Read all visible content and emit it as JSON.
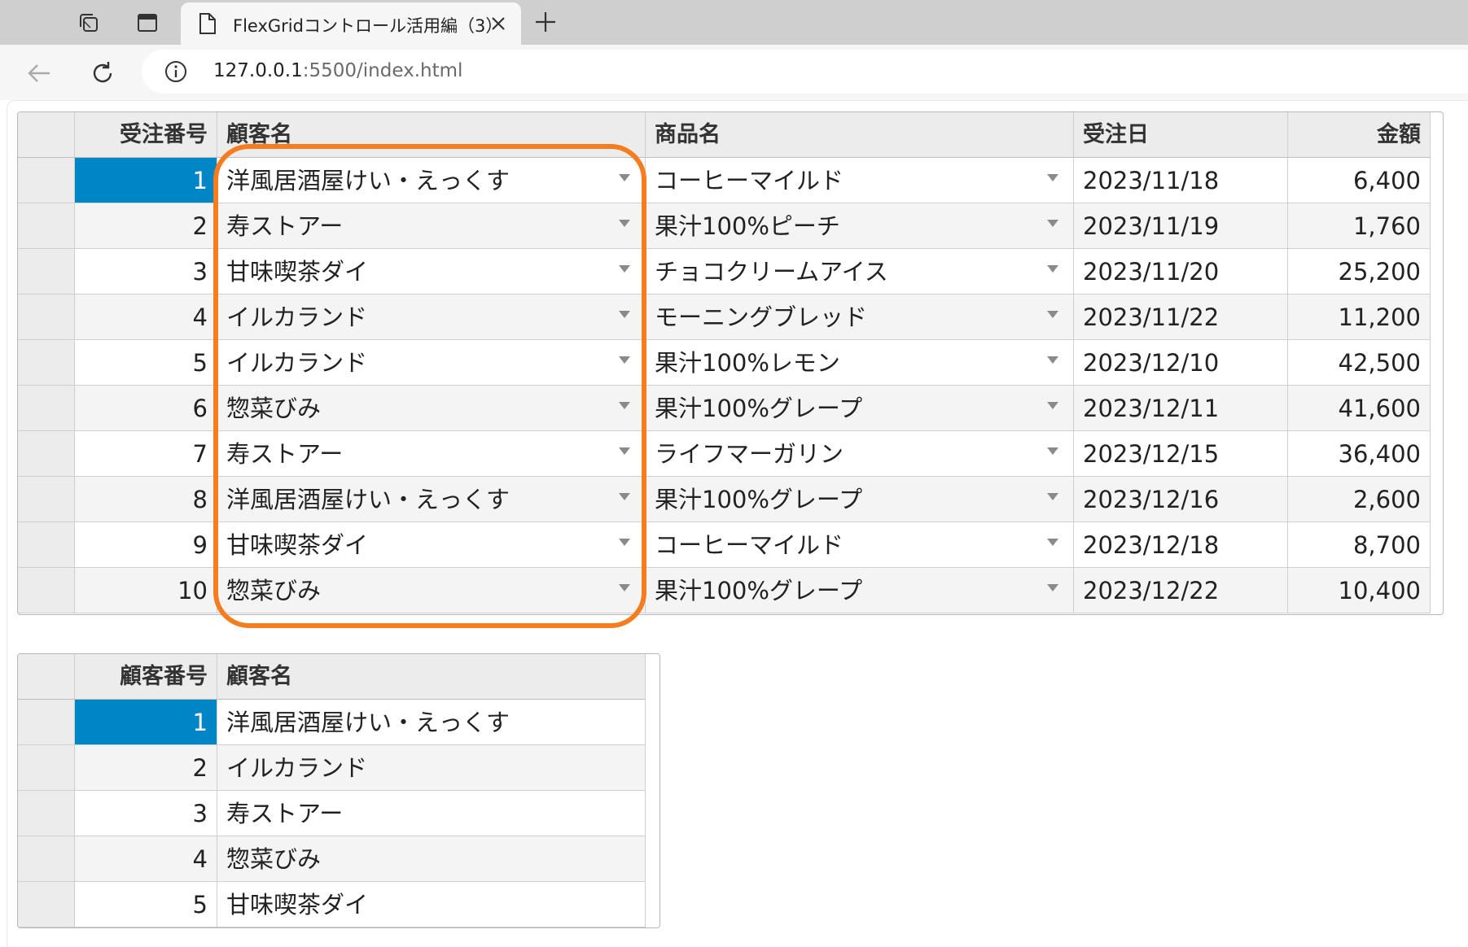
{
  "browser": {
    "tab_title": "FlexGridコントロール活用編（3）",
    "url_host": "127.0.0.1",
    "url_rest": ":5500/index.html"
  },
  "orders_grid": {
    "columns": [
      "受注番号",
      "顧客名",
      "商品名",
      "受注日",
      "金額"
    ],
    "rows": [
      {
        "no": "1",
        "customer": "洋風居酒屋けい・えっくす",
        "product": "コーヒーマイルド",
        "date": "2023/11/18",
        "amount": "6,400"
      },
      {
        "no": "2",
        "customer": "寿ストアー",
        "product": "果汁100%ピーチ",
        "date": "2023/11/19",
        "amount": "1,760"
      },
      {
        "no": "3",
        "customer": "甘味喫茶ダイ",
        "product": "チョコクリームアイス",
        "date": "2023/11/20",
        "amount": "25,200"
      },
      {
        "no": "4",
        "customer": "イルカランド",
        "product": "モーニングブレッド",
        "date": "2023/11/22",
        "amount": "11,200"
      },
      {
        "no": "5",
        "customer": "イルカランド",
        "product": "果汁100%レモン",
        "date": "2023/12/10",
        "amount": "42,500"
      },
      {
        "no": "6",
        "customer": "惣菜びみ",
        "product": "果汁100%グレープ",
        "date": "2023/12/11",
        "amount": "41,600"
      },
      {
        "no": "7",
        "customer": "寿ストアー",
        "product": "ライフマーガリン",
        "date": "2023/12/15",
        "amount": "36,400"
      },
      {
        "no": "8",
        "customer": "洋風居酒屋けい・えっくす",
        "product": "果汁100%グレープ",
        "date": "2023/12/16",
        "amount": "2,600"
      },
      {
        "no": "9",
        "customer": "甘味喫茶ダイ",
        "product": "コーヒーマイルド",
        "date": "2023/12/18",
        "amount": "8,700"
      },
      {
        "no": "10",
        "customer": "惣菜びみ",
        "product": "果汁100%グレープ",
        "date": "2023/12/22",
        "amount": "10,400"
      }
    ]
  },
  "customers_grid": {
    "columns": [
      "顧客番号",
      "顧客名"
    ],
    "rows": [
      {
        "no": "1",
        "name": "洋風居酒屋けい・えっくす"
      },
      {
        "no": "2",
        "name": "イルカランド"
      },
      {
        "no": "3",
        "name": "寿ストアー"
      },
      {
        "no": "4",
        "name": "惣菜びみ"
      },
      {
        "no": "5",
        "name": "甘味喫茶ダイ"
      }
    ]
  },
  "colors": {
    "selection": "#0085c7",
    "highlight": "#f57c1f",
    "header_bg": "#ececec"
  }
}
